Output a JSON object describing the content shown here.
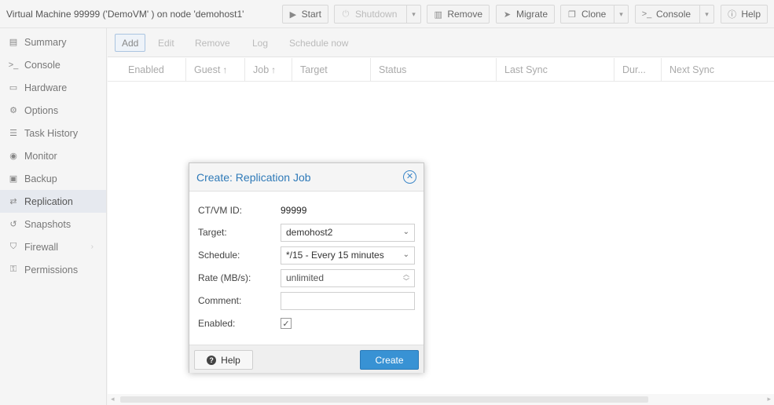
{
  "header": {
    "title": "Virtual Machine 99999 ('DemoVM' ) on node 'demohost1'",
    "buttons": [
      {
        "label": "Start",
        "icon": "play-icon",
        "glyph": "▶",
        "disabled": false,
        "dropdown": false
      },
      {
        "label": "Shutdown",
        "icon": "power-icon",
        "glyph": "⏻",
        "disabled": true,
        "dropdown": true
      },
      {
        "label": "Remove",
        "icon": "trash-icon",
        "glyph": "🗑",
        "disabled": false,
        "dropdown": false
      },
      {
        "label": "Migrate",
        "icon": "send-icon",
        "glyph": "➤",
        "disabled": false,
        "dropdown": false
      },
      {
        "label": "Clone",
        "icon": "clone-icon",
        "glyph": "❐",
        "disabled": false,
        "dropdown": true
      },
      {
        "label": "Console",
        "icon": "terminal-icon",
        "glyph": ">_",
        "disabled": false,
        "dropdown": true
      },
      {
        "label": "Help",
        "icon": "help-icon",
        "glyph": "?",
        "disabled": false,
        "dropdown": false
      }
    ]
  },
  "sidebar": {
    "items": [
      {
        "label": "Summary",
        "icon": "book-icon",
        "glyph": "▤"
      },
      {
        "label": "Console",
        "icon": "terminal-icon",
        "glyph": ">_"
      },
      {
        "label": "Hardware",
        "icon": "desktop-icon",
        "glyph": "▭"
      },
      {
        "label": "Options",
        "icon": "gear-icon",
        "glyph": "⚙"
      },
      {
        "label": "Task History",
        "icon": "list-icon",
        "glyph": "☰"
      },
      {
        "label": "Monitor",
        "icon": "eye-icon",
        "glyph": "◉"
      },
      {
        "label": "Backup",
        "icon": "floppy-icon",
        "glyph": "▣"
      },
      {
        "label": "Replication",
        "icon": "retweet-icon",
        "glyph": "⇄",
        "active": true
      },
      {
        "label": "Snapshots",
        "icon": "history-icon",
        "glyph": "↺"
      },
      {
        "label": "Firewall",
        "icon": "shield-icon",
        "glyph": "⛉",
        "expandable": true
      },
      {
        "label": "Permissions",
        "icon": "unlock-icon",
        "glyph": "🔓"
      }
    ]
  },
  "toolbar": {
    "add": "Add",
    "edit": "Edit",
    "remove": "Remove",
    "log": "Log",
    "schedule_now": "Schedule now"
  },
  "grid": {
    "columns": [
      "Enabled",
      "Guest",
      "Job",
      "Target",
      "Status",
      "Last Sync",
      "Dur...",
      "Next Sync"
    ],
    "sort_arrow": "↑"
  },
  "dialog": {
    "title": "Create: Replication Job",
    "fields": {
      "ctvm_label": "CT/VM ID:",
      "ctvm_value": "99999",
      "target_label": "Target:",
      "target_value": "demohost2",
      "schedule_label": "Schedule:",
      "schedule_value": "*/15 - Every 15 minutes",
      "rate_label": "Rate (MB/s):",
      "rate_placeholder": "unlimited",
      "comment_label": "Comment:",
      "comment_value": "",
      "enabled_label": "Enabled:",
      "enabled_checked": true
    },
    "help_label": "Help",
    "create_label": "Create"
  },
  "colors": {
    "accent": "#3892d4",
    "title_blue": "#2f7ab8",
    "active_sidebar_bg": "#e6e9ef"
  }
}
